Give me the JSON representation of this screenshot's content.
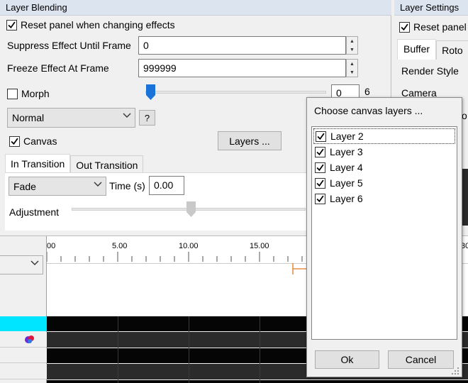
{
  "layer_blending": {
    "title": "Layer Blending",
    "reset_label": "Reset panel when changing effects",
    "suppress_label": "Suppress Effect Until Frame",
    "suppress_value": "0",
    "freeze_label": "Freeze Effect At Frame",
    "freeze_value": "999999",
    "morph_label": "Morph",
    "morph_value": "0",
    "morph_edge_glyph": "6",
    "blend_mode": "Normal",
    "help_label": "?",
    "canvas_label": "Canvas",
    "layers_button": "Layers ...",
    "tabs": [
      "In Transition",
      "Out Transition"
    ],
    "transition_type": "Fade",
    "time_label": "Time (s)",
    "time_value": "0.00",
    "adjustment_label": "Adjustment",
    "adjustment_level": 0.52
  },
  "layer_settings": {
    "title": "Layer Settings",
    "reset_label": "Reset panel",
    "tabs": [
      "Buffer",
      "Roto"
    ],
    "render_style_label": "Render Style",
    "camera_label": "Camera",
    "cutoff_glyph": "o"
  },
  "timeline": {
    "ticks": [
      "00",
      "5.00",
      "10.00",
      "15.00",
      "30"
    ]
  },
  "dialog": {
    "title": "Choose canvas layers ...",
    "items": [
      {
        "label": "Layer 2",
        "checked": true
      },
      {
        "label": "Layer 3",
        "checked": true
      },
      {
        "label": "Layer 4",
        "checked": true
      },
      {
        "label": "Layer 5",
        "checked": true
      },
      {
        "label": "Layer 6",
        "checked": true
      }
    ],
    "ok_label": "Ok",
    "cancel_label": "Cancel"
  },
  "colors": {
    "slider_thumb": "#1a73d9",
    "timeline_cyan": "#00e5ff",
    "marker_orange": "#e07a1f"
  }
}
